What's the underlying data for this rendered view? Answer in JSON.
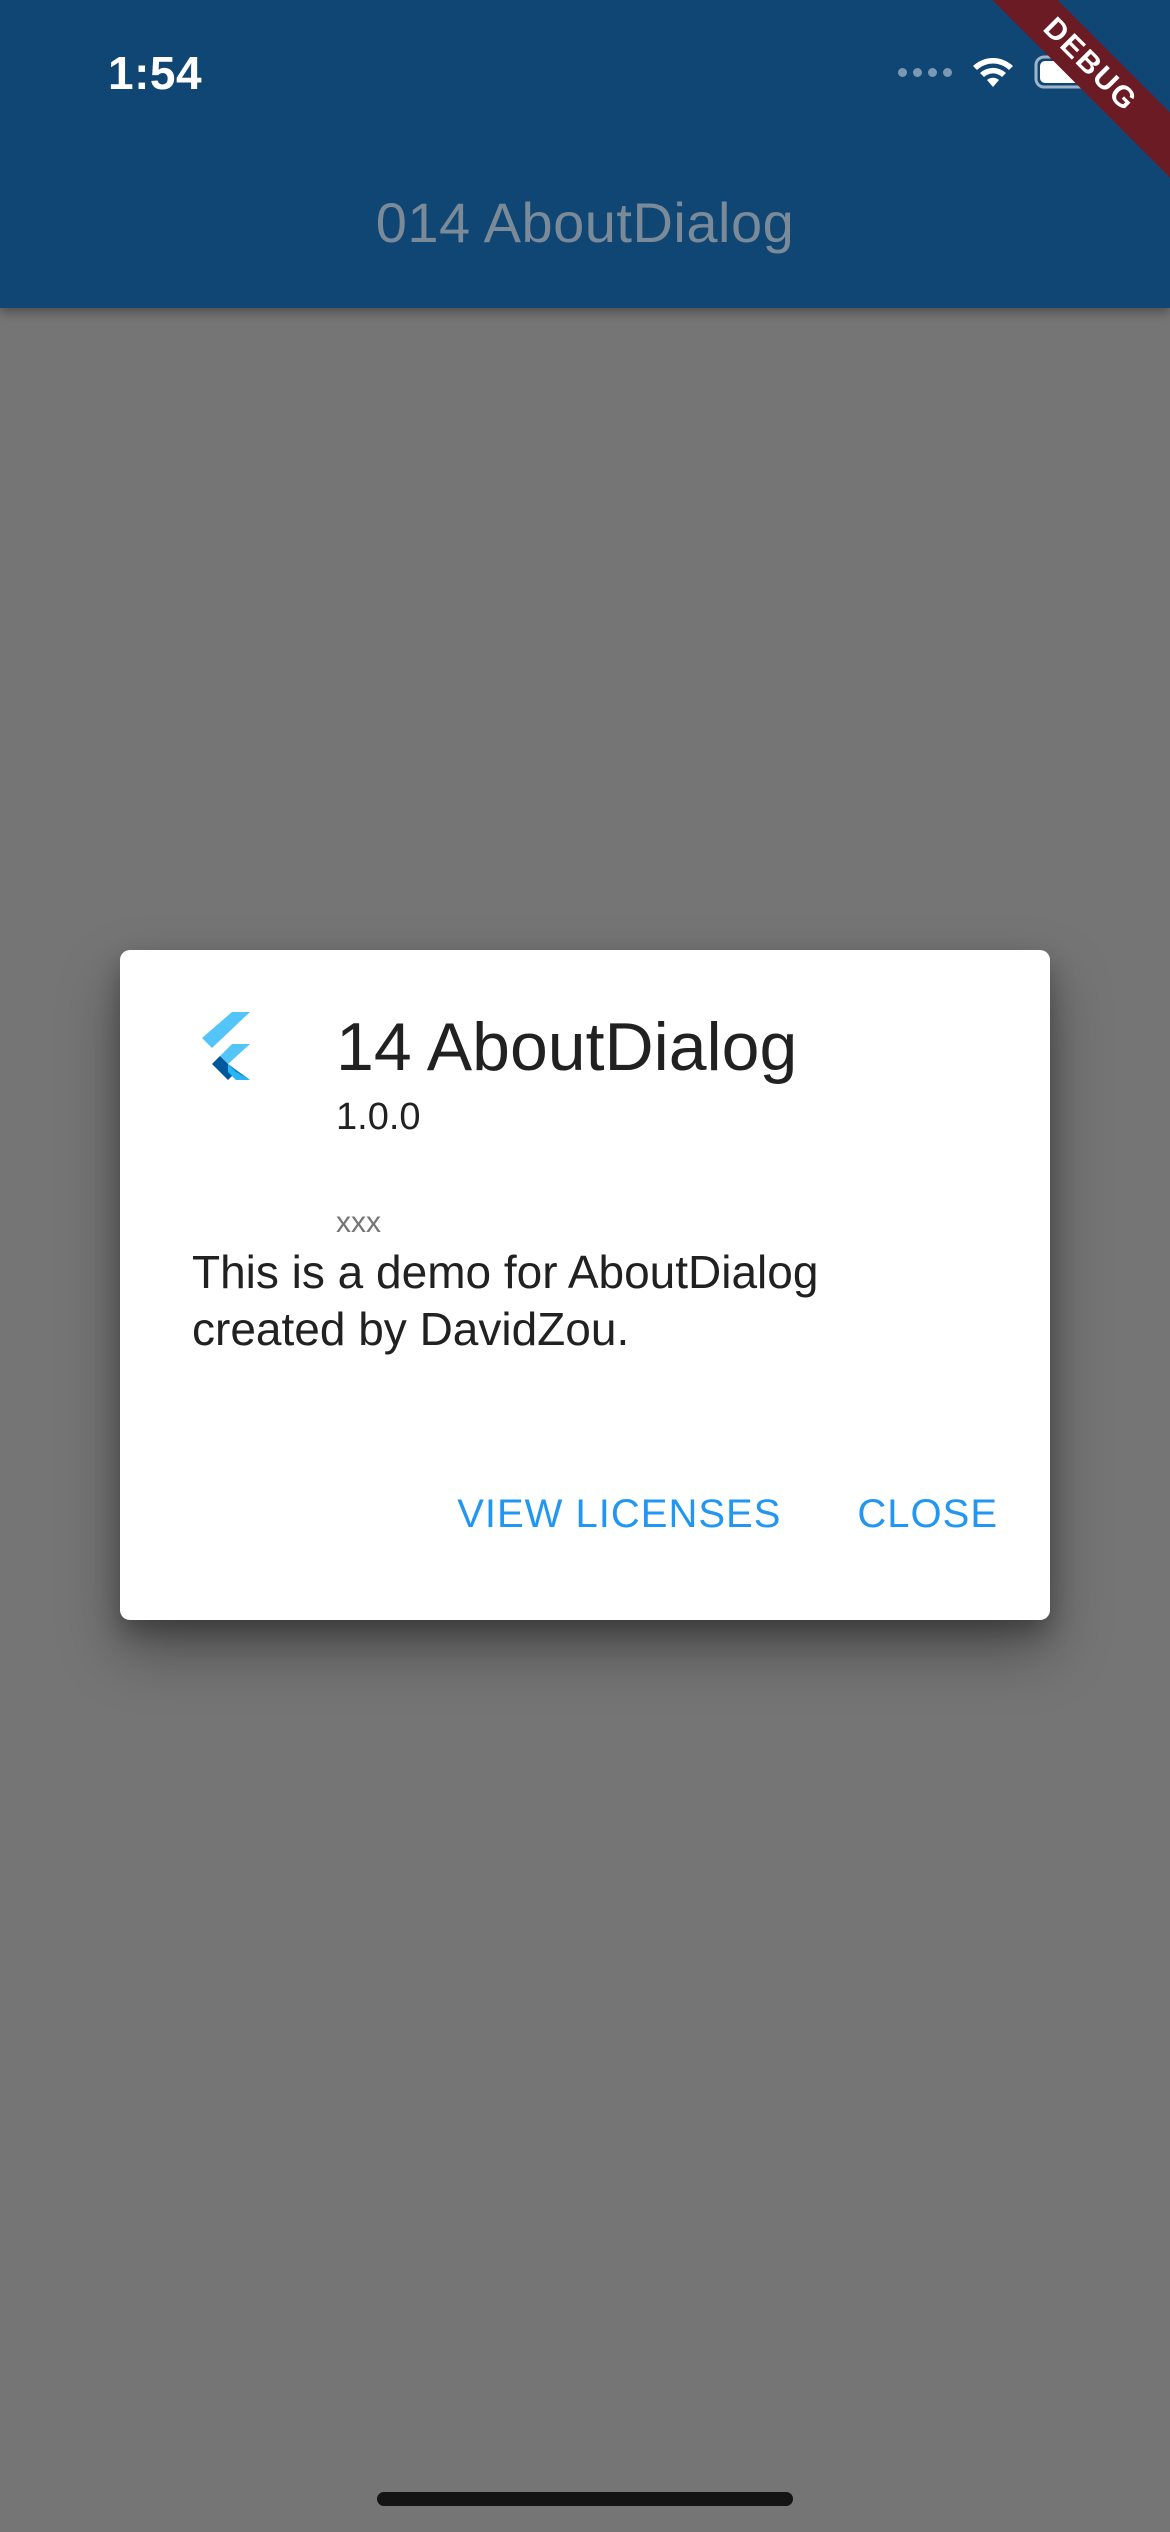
{
  "status_bar": {
    "time": "1:54"
  },
  "app_bar": {
    "title": "014 AboutDialog",
    "debug_banner": "DEBUG"
  },
  "dialog": {
    "app_name": "14 AboutDialog",
    "version": "1.0.0",
    "legalese": "xxx",
    "body": "This is a demo for AboutDialog created by DavidZou.",
    "actions": {
      "view_licenses": "VIEW LICENSES",
      "close": "CLOSE"
    }
  },
  "colors": {
    "app_bar": "#0f4674",
    "barrier": "#757575",
    "accent": "#2196f3",
    "debug_ribbon": "#6a1b24"
  },
  "icons": {
    "app_icon": "flutter-logo-icon",
    "wifi": "wifi-icon",
    "battery": "battery-icon",
    "signal": "signal-icon"
  }
}
